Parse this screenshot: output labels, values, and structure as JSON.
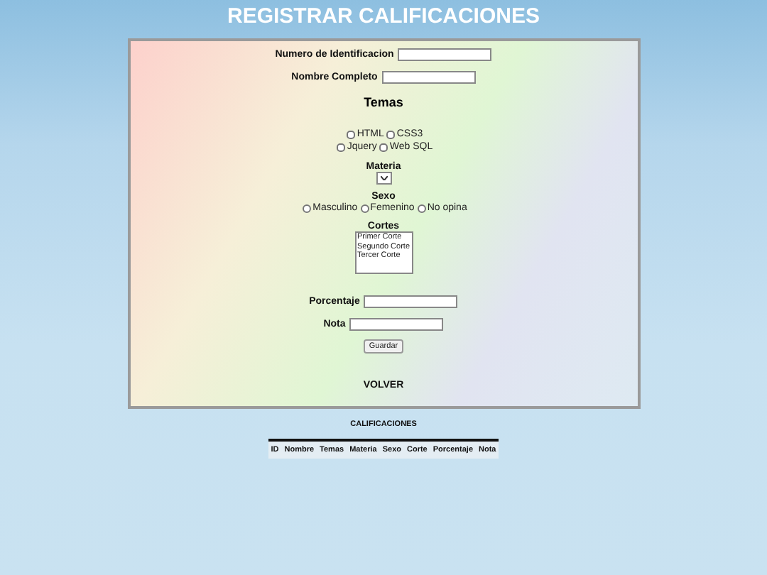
{
  "title": "REGISTRAR CALIFICACIONES",
  "id_field": {
    "label": "Numero de Identificacion"
  },
  "name_field": {
    "label": "Nombre Completo"
  },
  "temas": {
    "heading": "Temas",
    "options": [
      {
        "label": "HTML",
        "checked": false
      },
      {
        "label": "CSS3",
        "checked": false
      },
      {
        "label": "Jquery",
        "checked": false
      },
      {
        "label": "Web SQL",
        "checked": false
      }
    ]
  },
  "materia": {
    "label": "Materia"
  },
  "sexo": {
    "label": "Sexo",
    "options": [
      {
        "label": "Masculino",
        "selected": false
      },
      {
        "label": "Femenino",
        "selected": false
      },
      {
        "label": "No opina",
        "selected": false
      }
    ]
  },
  "cortes": {
    "label": "Cortes",
    "options": [
      {
        "label": "Primer Corte",
        "selected": false
      },
      {
        "label": "Segundo Corte",
        "selected": false
      },
      {
        "label": "Tercer Corte",
        "selected": false
      }
    ]
  },
  "porcentaje": {
    "label": "Porcentaje"
  },
  "nota": {
    "label": "Nota"
  },
  "save_button": "Guardar",
  "back_link": "VOLVER",
  "table": {
    "title": "CALIFICACIONES",
    "columns": [
      "ID",
      "Nombre",
      "Temas",
      "Materia",
      "Sexo",
      "Corte",
      "Porcentaje",
      "Nota"
    ]
  }
}
